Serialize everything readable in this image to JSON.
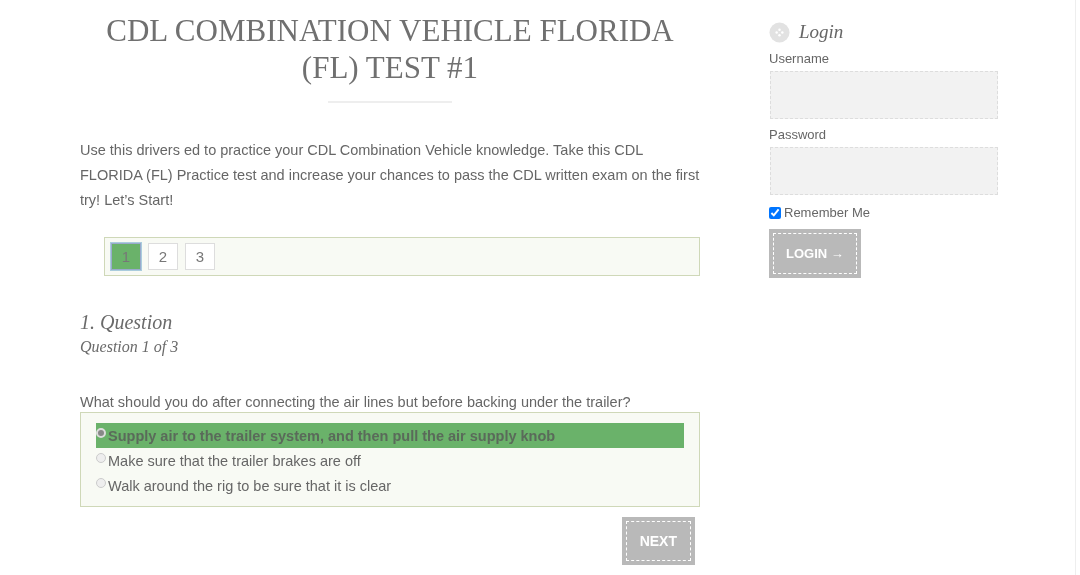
{
  "title": "CDL COMBINATION VEHICLE FLORIDA (FL) TEST #1",
  "intro": "Use this drivers ed to practice your CDL Combination Vehicle knowledge. Take this CDL FLORIDA (FL) Practice test and increase your chances to pass the CDL written exam on the first try! Let’s Start!",
  "pages": [
    {
      "label": "1",
      "selected": true
    },
    {
      "label": "2",
      "selected": false
    },
    {
      "label": "3",
      "selected": false
    }
  ],
  "question": {
    "heading": "1. Question",
    "counter": "Question 1 of 3",
    "text": "What should you do after connecting the air lines but before backing under the trailer?",
    "answers": [
      {
        "label": "Supply air to the trailer system, and then pull the air supply knob",
        "selected": true
      },
      {
        "label": "Make sure that the trailer brakes are off",
        "selected": false
      },
      {
        "label": "Walk around the rig to be sure that it is clear",
        "selected": false
      }
    ],
    "next_button": "NEXT"
  },
  "login": {
    "title": "Login",
    "username_label": "Username",
    "password_label": "Password",
    "remember": {
      "label": "Remember Me",
      "checked": true
    },
    "button": "LOGIN →"
  }
}
